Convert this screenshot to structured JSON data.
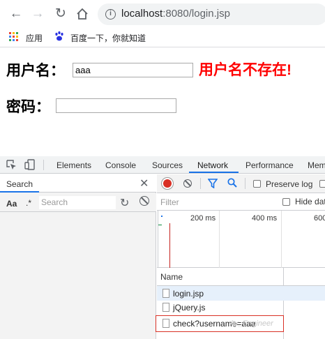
{
  "browser": {
    "url_host": "localhost",
    "url_path": ":8080/login.jsp",
    "bookmarks": [
      {
        "label": "应用"
      },
      {
        "label": "百度一下，你就知道"
      }
    ]
  },
  "page": {
    "username_label": "用户名：",
    "username_value": "aaa",
    "error_message": "用户名不存在!",
    "error_color": "#ff0000",
    "password_label": "密码：",
    "password_value": ""
  },
  "devtools": {
    "tabs": [
      {
        "label": "Elements"
      },
      {
        "label": "Console"
      },
      {
        "label": "Sources"
      },
      {
        "label": "Network",
        "active": true
      },
      {
        "label": "Performance"
      },
      {
        "label": "Mem"
      }
    ],
    "search_panel": {
      "title": "Search",
      "case_toggle": "Aa",
      "regex_toggle": ".*",
      "placeholder": "Search"
    },
    "network": {
      "preserve_log_label": "Preserve log",
      "filter_placeholder": "Filter",
      "hide_label": "Hide dat",
      "timeline_labels": [
        "200 ms",
        "400 ms",
        "600"
      ],
      "name_header": "Name",
      "requests": [
        {
          "name": "login.jsp",
          "selected": true
        },
        {
          "name": "jQuery.js",
          "selected": false
        },
        {
          "name": "check?username=aaa",
          "selected": false
        }
      ]
    },
    "accent_color": "#1a73e8"
  },
  "watermark": "/ty_Engineer"
}
